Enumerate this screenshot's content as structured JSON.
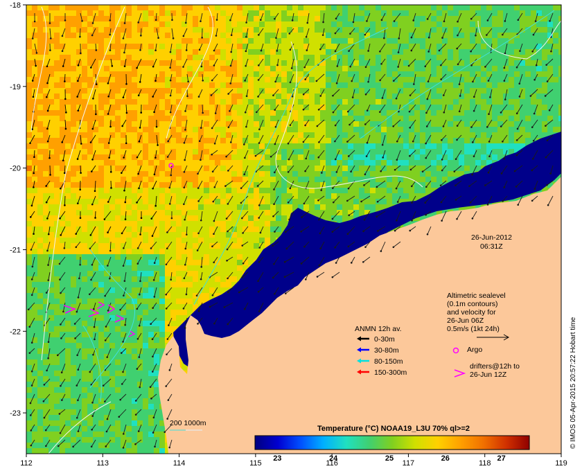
{
  "map": {
    "lon_ticks": [
      "112",
      "113",
      "114",
      "115",
      "116",
      "117",
      "118",
      "119"
    ],
    "lat_ticks": [
      "-18",
      "-19",
      "-20",
      "-21",
      "-22",
      "-23"
    ],
    "lon_range": [
      112,
      119
    ],
    "lat_range": [
      -23.5,
      -18
    ]
  },
  "timestamp": {
    "date": "26-Jun-2012",
    "time": "06:31Z"
  },
  "sealevel_note": {
    "line1": "Altimetric sealevel",
    "line2": "(0.1m contours)",
    "line3": "and velocity for",
    "line4": "26-Jun 06Z",
    "line5": "0.5m/s (1kt 24h)"
  },
  "legend": {
    "title": "ANMN 12h av.",
    "items": [
      {
        "label": "0-30m",
        "color": "#000000"
      },
      {
        "label": "30-80m",
        "color": "#0000ff"
      },
      {
        "label": "80-150m",
        "color": "#00e0e0"
      },
      {
        "label": "150-300m",
        "color": "#ff0000"
      }
    ],
    "argo_label": "Argo",
    "argo_color": "#ff00ff",
    "drifters_line1": "drifters@12h to",
    "drifters_line2": "26-Jun 12Z",
    "drifters_color": "#ff00ff"
  },
  "bathymetry_label": "200  1000m",
  "colorbar": {
    "title": "Temperature (°C) NOAA19_L3U 70% ql>=2",
    "ticks": [
      "23",
      "24",
      "25",
      "26",
      "27"
    ],
    "range": [
      22.6,
      27.5
    ],
    "colors": [
      "#00007f",
      "#0000d0",
      "#0050ff",
      "#00b0ff",
      "#20e0c0",
      "#40d070",
      "#80d020",
      "#d0e000",
      "#ffd000",
      "#ffa000",
      "#f07000",
      "#d03000",
      "#900000"
    ]
  },
  "credit": "© IMOS 05-Apr-2015 20:57:22 Hobart time",
  "colors": {
    "land": "#fcc89a",
    "deep_ocean": "#00008a"
  }
}
